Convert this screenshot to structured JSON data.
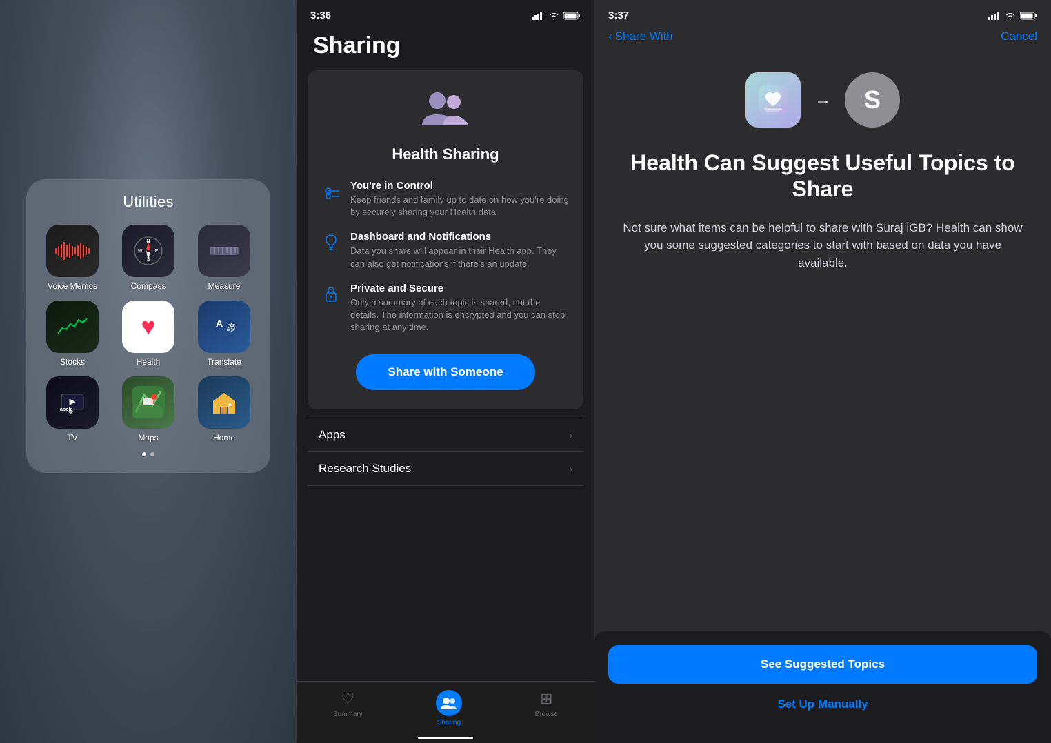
{
  "panel1": {
    "folder_title": "Utilities",
    "apps": [
      {
        "name": "Voice Memos",
        "icon_type": "voice_memos"
      },
      {
        "name": "Compass",
        "icon_type": "compass"
      },
      {
        "name": "Measure",
        "icon_type": "measure"
      },
      {
        "name": "Stocks",
        "icon_type": "stocks"
      },
      {
        "name": "Health",
        "icon_type": "health"
      },
      {
        "name": "Translate",
        "icon_type": "translate"
      },
      {
        "name": "TV",
        "icon_type": "tv"
      },
      {
        "name": "Maps",
        "icon_type": "maps"
      },
      {
        "name": "Home",
        "icon_type": "home"
      }
    ]
  },
  "panel2": {
    "time": "3:36",
    "title": "Sharing",
    "card": {
      "title": "Health Sharing",
      "features": [
        {
          "title": "You're in Control",
          "desc": "Keep friends and family up to date on how you're doing by securely sharing your Health data."
        },
        {
          "title": "Dashboard and Notifications",
          "desc": "Data you share will appear in their Health app. They can also get notifications if there's an update."
        },
        {
          "title": "Private and Secure",
          "desc": "Only a summary of each topic is shared, not the details. The information is encrypted and you can stop sharing at any time."
        }
      ],
      "button_label": "Share with Someone"
    },
    "list_items": [
      {
        "label": "Apps"
      },
      {
        "label": "Research Studies"
      }
    ],
    "tabs": [
      {
        "label": "Summary",
        "icon": "♡",
        "active": false
      },
      {
        "label": "Sharing",
        "icon": "👥",
        "active": true
      },
      {
        "label": "Browse",
        "icon": "⊞",
        "active": false
      }
    ]
  },
  "panel3": {
    "time": "3:37",
    "nav": {
      "back_label": "Share With",
      "cancel_label": "Cancel"
    },
    "avatar_letter": "S",
    "title": "Health Can Suggest Useful Topics to Share",
    "description": "Not sure what items can be helpful to share with Suraj iGB? Health can show you some suggested categories to start with based on data you have available.",
    "btn_primary": "See Suggested Topics",
    "btn_secondary": "Set Up Manually"
  }
}
